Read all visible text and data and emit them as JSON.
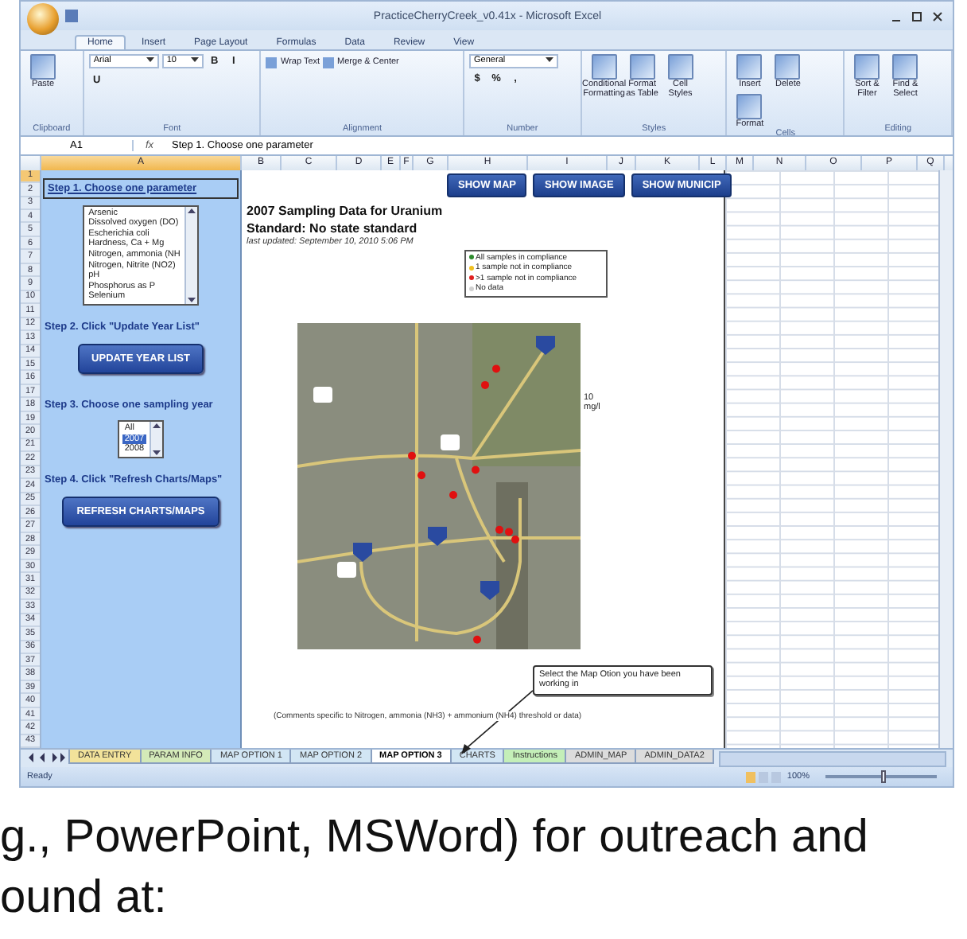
{
  "window": {
    "title": "PracticeCherryCreek_v0.41x - Microsoft Excel"
  },
  "ribbon_tabs": [
    {
      "label": "Home",
      "selected": true
    },
    {
      "label": "Insert",
      "selected": false
    },
    {
      "label": "Page Layout",
      "selected": false
    },
    {
      "label": "Formulas",
      "selected": false
    },
    {
      "label": "Data",
      "selected": false
    },
    {
      "label": "Review",
      "selected": false
    },
    {
      "label": "View",
      "selected": false
    }
  ],
  "ribbon_groups": [
    {
      "label": "Clipboard",
      "items": [
        {
          "kind": "large",
          "label": "Paste"
        }
      ]
    },
    {
      "label": "Font",
      "items": [
        {
          "kind": "combo",
          "label": "Arial"
        },
        {
          "kind": "combo",
          "label": "10"
        },
        {
          "kind": "glyph",
          "label": "B"
        },
        {
          "kind": "glyph",
          "label": "I"
        },
        {
          "kind": "glyph",
          "label": "U"
        }
      ]
    },
    {
      "label": "Alignment",
      "items": [
        {
          "kind": "small",
          "label": "Wrap Text"
        },
        {
          "kind": "small",
          "label": "Merge & Center"
        }
      ]
    },
    {
      "label": "Number",
      "items": [
        {
          "kind": "combo",
          "label": "General"
        },
        {
          "kind": "glyph",
          "label": "$"
        },
        {
          "kind": "glyph",
          "label": "%"
        },
        {
          "kind": "glyph",
          "label": ","
        }
      ]
    },
    {
      "label": "Styles",
      "items": [
        {
          "kind": "large",
          "label": "Conditional Formatting"
        },
        {
          "kind": "large",
          "label": "Format as Table"
        },
        {
          "kind": "large",
          "label": "Cell Styles"
        }
      ]
    },
    {
      "label": "Cells",
      "items": [
        {
          "kind": "large",
          "label": "Insert"
        },
        {
          "kind": "large",
          "label": "Delete"
        },
        {
          "kind": "large",
          "label": "Format"
        }
      ]
    },
    {
      "label": "Editing",
      "items": [
        {
          "kind": "large",
          "label": "Sort & Filter"
        },
        {
          "kind": "large",
          "label": "Find & Select"
        }
      ]
    }
  ],
  "formula_bar": {
    "cell": "A1",
    "fx": "fx",
    "value": "Step 1. Choose one parameter"
  },
  "columns": [
    {
      "label": "A",
      "selected": true
    },
    {
      "label": "B",
      "selected": false
    },
    {
      "label": "C",
      "selected": false
    },
    {
      "label": "D",
      "selected": false
    },
    {
      "label": "E",
      "selected": false
    },
    {
      "label": "F",
      "selected": false
    },
    {
      "label": "G",
      "selected": false
    },
    {
      "label": "H",
      "selected": false
    },
    {
      "label": "I",
      "selected": false
    },
    {
      "label": "J",
      "selected": false
    },
    {
      "label": "K",
      "selected": false
    },
    {
      "label": "L",
      "selected": false
    },
    {
      "label": "M",
      "selected": false
    },
    {
      "label": "N",
      "selected": false
    },
    {
      "label": "O",
      "selected": false
    },
    {
      "label": "P",
      "selected": false
    },
    {
      "label": "Q",
      "selected": false
    }
  ],
  "rows": [
    {
      "label": "1",
      "selected": true
    },
    {
      "label": "2",
      "selected": false
    },
    {
      "label": "3",
      "selected": false
    },
    {
      "label": "4",
      "selected": false
    },
    {
      "label": "5",
      "selected": false
    },
    {
      "label": "6",
      "selected": false
    },
    {
      "label": "7",
      "selected": false
    },
    {
      "label": "8",
      "selected": false
    },
    {
      "label": "9",
      "selected": false
    },
    {
      "label": "10",
      "selected": false
    },
    {
      "label": "11",
      "selected": false
    },
    {
      "label": "12",
      "selected": false
    },
    {
      "label": "13",
      "selected": false
    },
    {
      "label": "14",
      "selected": false
    },
    {
      "label": "15",
      "selected": false
    },
    {
      "label": "16",
      "selected": false
    },
    {
      "label": "17",
      "selected": false
    },
    {
      "label": "18",
      "selected": false
    },
    {
      "label": "19",
      "selected": false
    },
    {
      "label": "20",
      "selected": false
    },
    {
      "label": "21",
      "selected": false
    },
    {
      "label": "22",
      "selected": false
    },
    {
      "label": "23",
      "selected": false
    },
    {
      "label": "24",
      "selected": false
    },
    {
      "label": "25",
      "selected": false
    },
    {
      "label": "26",
      "selected": false
    },
    {
      "label": "27",
      "selected": false
    },
    {
      "label": "28",
      "selected": false
    },
    {
      "label": "29",
      "selected": false
    },
    {
      "label": "30",
      "selected": false
    },
    {
      "label": "31",
      "selected": false
    },
    {
      "label": "32",
      "selected": false
    },
    {
      "label": "33",
      "selected": false
    },
    {
      "label": "34",
      "selected": false
    },
    {
      "label": "35",
      "selected": false
    },
    {
      "label": "36",
      "selected": false
    },
    {
      "label": "37",
      "selected": false
    },
    {
      "label": "38",
      "selected": false
    },
    {
      "label": "39",
      "selected": false
    },
    {
      "label": "40",
      "selected": false
    },
    {
      "label": "41",
      "selected": false
    },
    {
      "label": "42",
      "selected": false
    },
    {
      "label": "43",
      "selected": false
    }
  ],
  "panel": [
    {
      "kind": "heading",
      "text": "Step 1. Choose one parameter"
    },
    {
      "kind": "listbox",
      "options": [
        {
          "label": "Arsenic",
          "selected": false
        },
        {
          "label": "Dissolved oxygen (DO)",
          "selected": false
        },
        {
          "label": "Escherichia coli",
          "selected": false
        },
        {
          "label": "Hardness, Ca + Mg",
          "selected": false
        },
        {
          "label": "Nitrogen, ammonia (NH",
          "selected": false
        },
        {
          "label": "Nitrogen, Nitrite (NO2)",
          "selected": false
        },
        {
          "label": "pH",
          "selected": false
        },
        {
          "label": "Phosphorus as P",
          "selected": false
        },
        {
          "label": "Selenium",
          "selected": false
        }
      ]
    },
    {
      "kind": "heading",
      "text": "Step 2. Click \"Update Year List\""
    },
    {
      "kind": "button",
      "text": "UPDATE YEAR LIST"
    },
    {
      "kind": "heading",
      "text": "Step 3. Choose one sampling year"
    },
    {
      "kind": "listbox",
      "options": [
        {
          "label": "All",
          "selected": false
        },
        {
          "label": "2007",
          "selected": true
        },
        {
          "label": "2008",
          "selected": false
        }
      ]
    },
    {
      "kind": "heading",
      "text": "Step 4. Click \"Refresh Charts/Maps\""
    },
    {
      "kind": "button",
      "text": "REFRESH CHARTS/MAPS"
    }
  ],
  "sheet_buttons": [
    "SHOW MAP",
    "SHOW IMAGE",
    "SHOW MUNICIP"
  ],
  "report": {
    "title": "2007 Sampling Data for Uranium",
    "standard": "Standard: No state standard",
    "updated": "last updated: September 10, 2010 5:06 PM",
    "legend": [
      {
        "label": "All samples in compliance",
        "color": "#2e8b2e"
      },
      {
        "label": "1 sample not in compliance",
        "color": "#f0c020"
      },
      {
        "label": ">1 sample not in compliance",
        "color": "#e02020"
      },
      {
        "label": "No data",
        "color": "#d0d0d0"
      }
    ],
    "side_value": "10",
    "side_unit": "mg/l",
    "callout": "Select the Map Otion you have been working in",
    "comment": "(Comments specific to Nitrogen, ammonia (NH3) + ammonium (NH4) threshold or data)"
  },
  "sheet_tabs": [
    {
      "label": "DATA ENTRY",
      "selected": false,
      "color": "#f2e29a"
    },
    {
      "label": "PARAM INFO",
      "selected": false,
      "color": "#d4eab8"
    },
    {
      "label": "MAP OPTION 1",
      "selected": false,
      "color": "#d2e6f4"
    },
    {
      "label": "MAP OPTION 2",
      "selected": false,
      "color": "#d2e6f4"
    },
    {
      "label": "MAP OPTION 3",
      "selected": true,
      "color": "#ffffff"
    },
    {
      "label": "CHARTS",
      "selected": false,
      "color": "#d2e6f4"
    },
    {
      "label": "Instructions",
      "selected": false,
      "color": "#c4efb8"
    },
    {
      "label": "ADMIN_MAP",
      "selected": false,
      "color": "#dcdcdc"
    },
    {
      "label": "ADMIN_DATA2",
      "selected": false,
      "color": "#dcdcdc"
    }
  ],
  "status_bar": {
    "status": "Ready",
    "zoom": "100%",
    "level": 0.5
  },
  "slide_text": [
    "g., PowerPoint, MSWord) for outreach and",
    "ound at:"
  ]
}
